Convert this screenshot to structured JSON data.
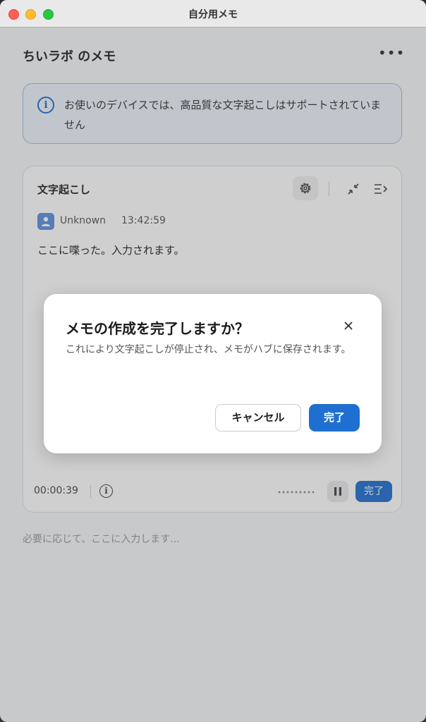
{
  "window": {
    "title": "自分用メモ"
  },
  "header": {
    "title": "ちいラボ のメモ",
    "more": "•••"
  },
  "banner": {
    "text": "お使いのデバイスでは、高品質な文字起こしはサポートされていません"
  },
  "transcription": {
    "title": "文字起こし",
    "speaker": "Unknown",
    "timestamp": "13:42:59",
    "text": "ここに喋った。入力されます。",
    "elapsed": "00:00:39",
    "done_label": "完了"
  },
  "notes": {
    "placeholder": "必要に応じて、ここに入力します..."
  },
  "dialog": {
    "title": "メモの作成を完了しますか？",
    "body": "これにより文字起こしが停止され、メモがハブに保存されます。",
    "cancel_label": "キャンセル",
    "confirm_label": "完了"
  },
  "colors": {
    "accent": "#1f6fd0",
    "banner_border": "#9cbce3",
    "banner_bg": "#edf3fb"
  }
}
